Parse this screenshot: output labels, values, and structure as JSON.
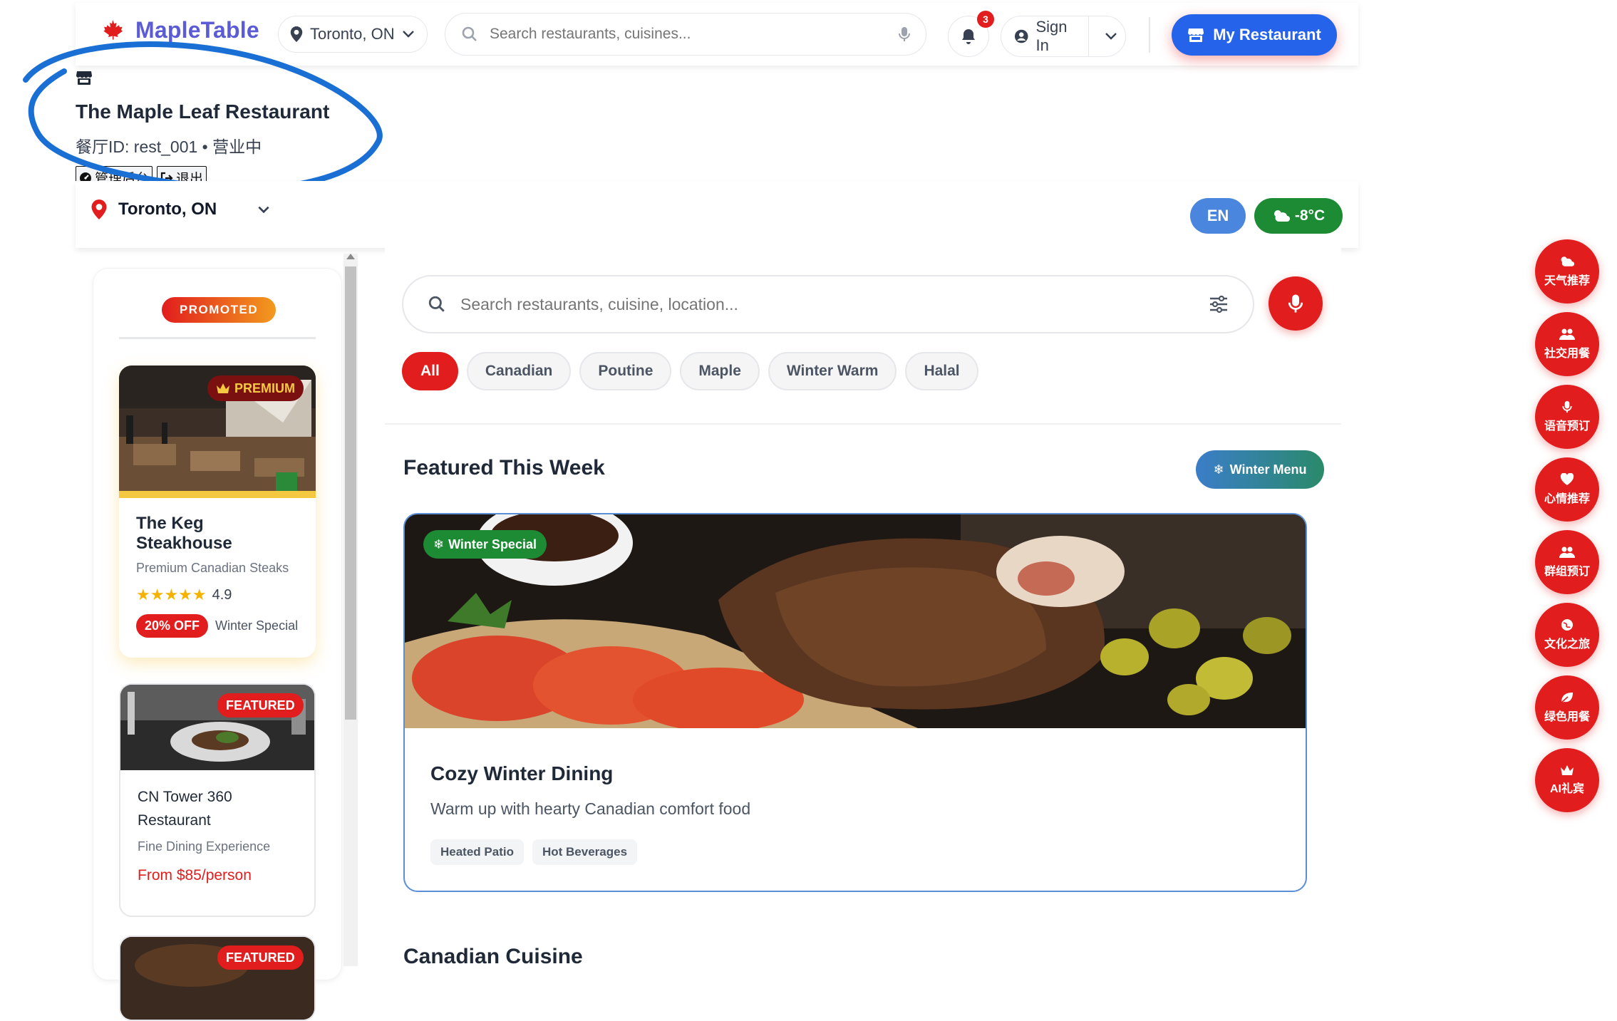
{
  "header": {
    "logo_text": "MapleTable",
    "location": "Toronto, ON",
    "search_placeholder": "Search restaurants, cuisines...",
    "notification_count": "3",
    "sign_in_label": "Sign In",
    "my_restaurant_label": "My Restaurant"
  },
  "owner_panel": {
    "restaurant_name": "The Maple Leaf Restaurant",
    "restaurant_meta": "餐厅ID: rest_001 • 营业中",
    "admin_label": "管理后台",
    "logout_label": "退出"
  },
  "sub_bar": {
    "location": "Toronto, ON",
    "language": "EN",
    "temperature": "-8°C"
  },
  "sidebar": {
    "promoted_label": "PROMOTED",
    "cards": [
      {
        "badge": "PREMIUM",
        "name": "The Keg Steakhouse",
        "subtitle": "Premium Canadian Steaks",
        "stars": "★★★★★",
        "rating": "4.9",
        "rating_value": 4.9,
        "discount": "20% OFF",
        "offer": "Winter Special"
      },
      {
        "badge": "FEATURED",
        "name": "CN Tower 360 Restaurant",
        "subtitle": "Fine Dining Experience",
        "price": "From $85/person"
      },
      {
        "badge": "FEATURED"
      }
    ]
  },
  "main": {
    "search_placeholder": "Search restaurants, cuisine, location...",
    "filters": [
      "All",
      "Canadian",
      "Poutine",
      "Maple",
      "Winter Warm",
      "Halal"
    ],
    "active_filter": "All",
    "featured_title": "Featured This Week",
    "winter_menu_label": "Winter Menu",
    "feature_card": {
      "badge": "Winter Special",
      "title": "Cozy Winter Dining",
      "description": "Warm up with hearty Canadian comfort food",
      "tags": [
        "Heated Patio",
        "Hot Beverages"
      ]
    },
    "next_section_title": "Canadian Cuisine"
  },
  "side_actions": [
    {
      "label": "天气推荐",
      "icon": "cloud-sun-icon"
    },
    {
      "label": "社交用餐",
      "icon": "users-icon"
    },
    {
      "label": "语音预订",
      "icon": "microphone-icon"
    },
    {
      "label": "心情推荐",
      "icon": "heart-icon"
    },
    {
      "label": "群组预订",
      "icon": "user-group-icon"
    },
    {
      "label": "文化之旅",
      "icon": "globe-icon"
    },
    {
      "label": "绿色用餐",
      "icon": "leaf-icon"
    },
    {
      "label": "AI礼宾",
      "icon": "crown-icon"
    }
  ],
  "colors": {
    "brand": "#5b5bd6",
    "primary_button": "#2563eb",
    "accent_red": "#e11d1d",
    "weather_green": "#1d8a34",
    "annotation_blue": "#1a6fd4"
  }
}
